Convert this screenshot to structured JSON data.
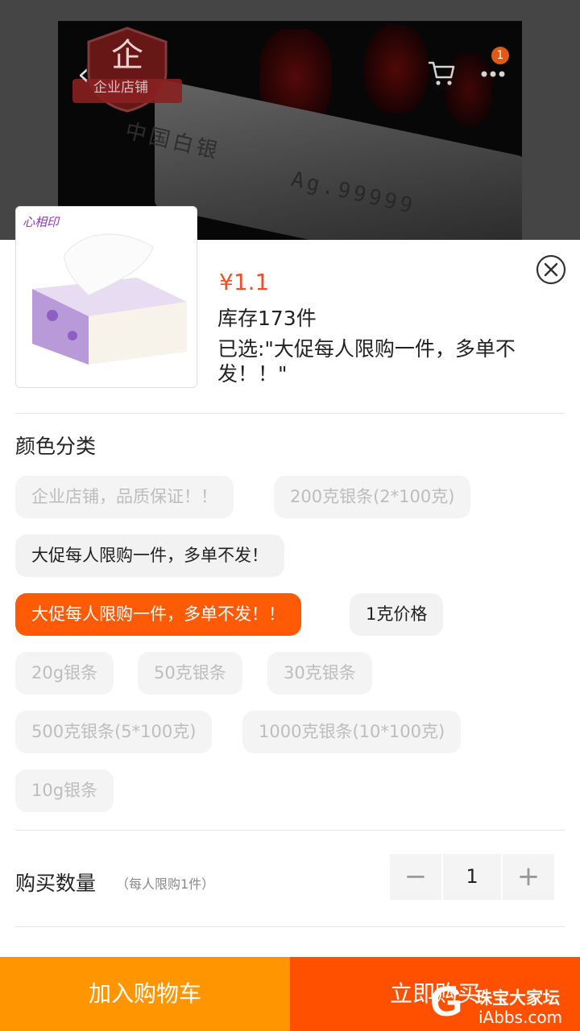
{
  "header": {
    "shop_badge_label": "企业店铺",
    "cart_badge_count": "1"
  },
  "hero": {
    "bar_text_1": "中国白银",
    "bar_text_2": "Ag.99999"
  },
  "product": {
    "price": "¥1.1",
    "stock": "库存173件",
    "selected": "已选:\"大促每人限购一件，多单不发！！\""
  },
  "sku": {
    "section_title": "颜色分类",
    "options": [
      {
        "label": "企业店铺，品质保证！！",
        "state": "disabled"
      },
      {
        "label": "200克银条(2*100克)",
        "state": "disabled"
      },
      {
        "label": "大促每人限购一件，多单不发！",
        "state": "normal"
      },
      {
        "label": "大促每人限购一件，多单不发！！",
        "state": "active"
      },
      {
        "label": "1克价格",
        "state": "normal"
      },
      {
        "label": "20g银条",
        "state": "disabled"
      },
      {
        "label": "50克银条",
        "state": "disabled"
      },
      {
        "label": "30克银条",
        "state": "disabled"
      },
      {
        "label": "500克银条(5*100克)",
        "state": "disabled"
      },
      {
        "label": "1000克银条(10*100克)",
        "state": "disabled"
      },
      {
        "label": "10g银条",
        "state": "disabled"
      }
    ]
  },
  "quantity": {
    "label": "购买数量",
    "note": "（每人限购1件）",
    "minus": "−",
    "value": "1",
    "plus": "+"
  },
  "actions": {
    "add_to_cart": "加入购物车",
    "buy_now": "立即购买"
  },
  "watermark": {
    "text": "珠宝大家坛",
    "url": "iAbbs.com"
  },
  "colors": {
    "accent": "#ff5000",
    "cart_button": "#ff9500",
    "price": "#f0501e"
  }
}
